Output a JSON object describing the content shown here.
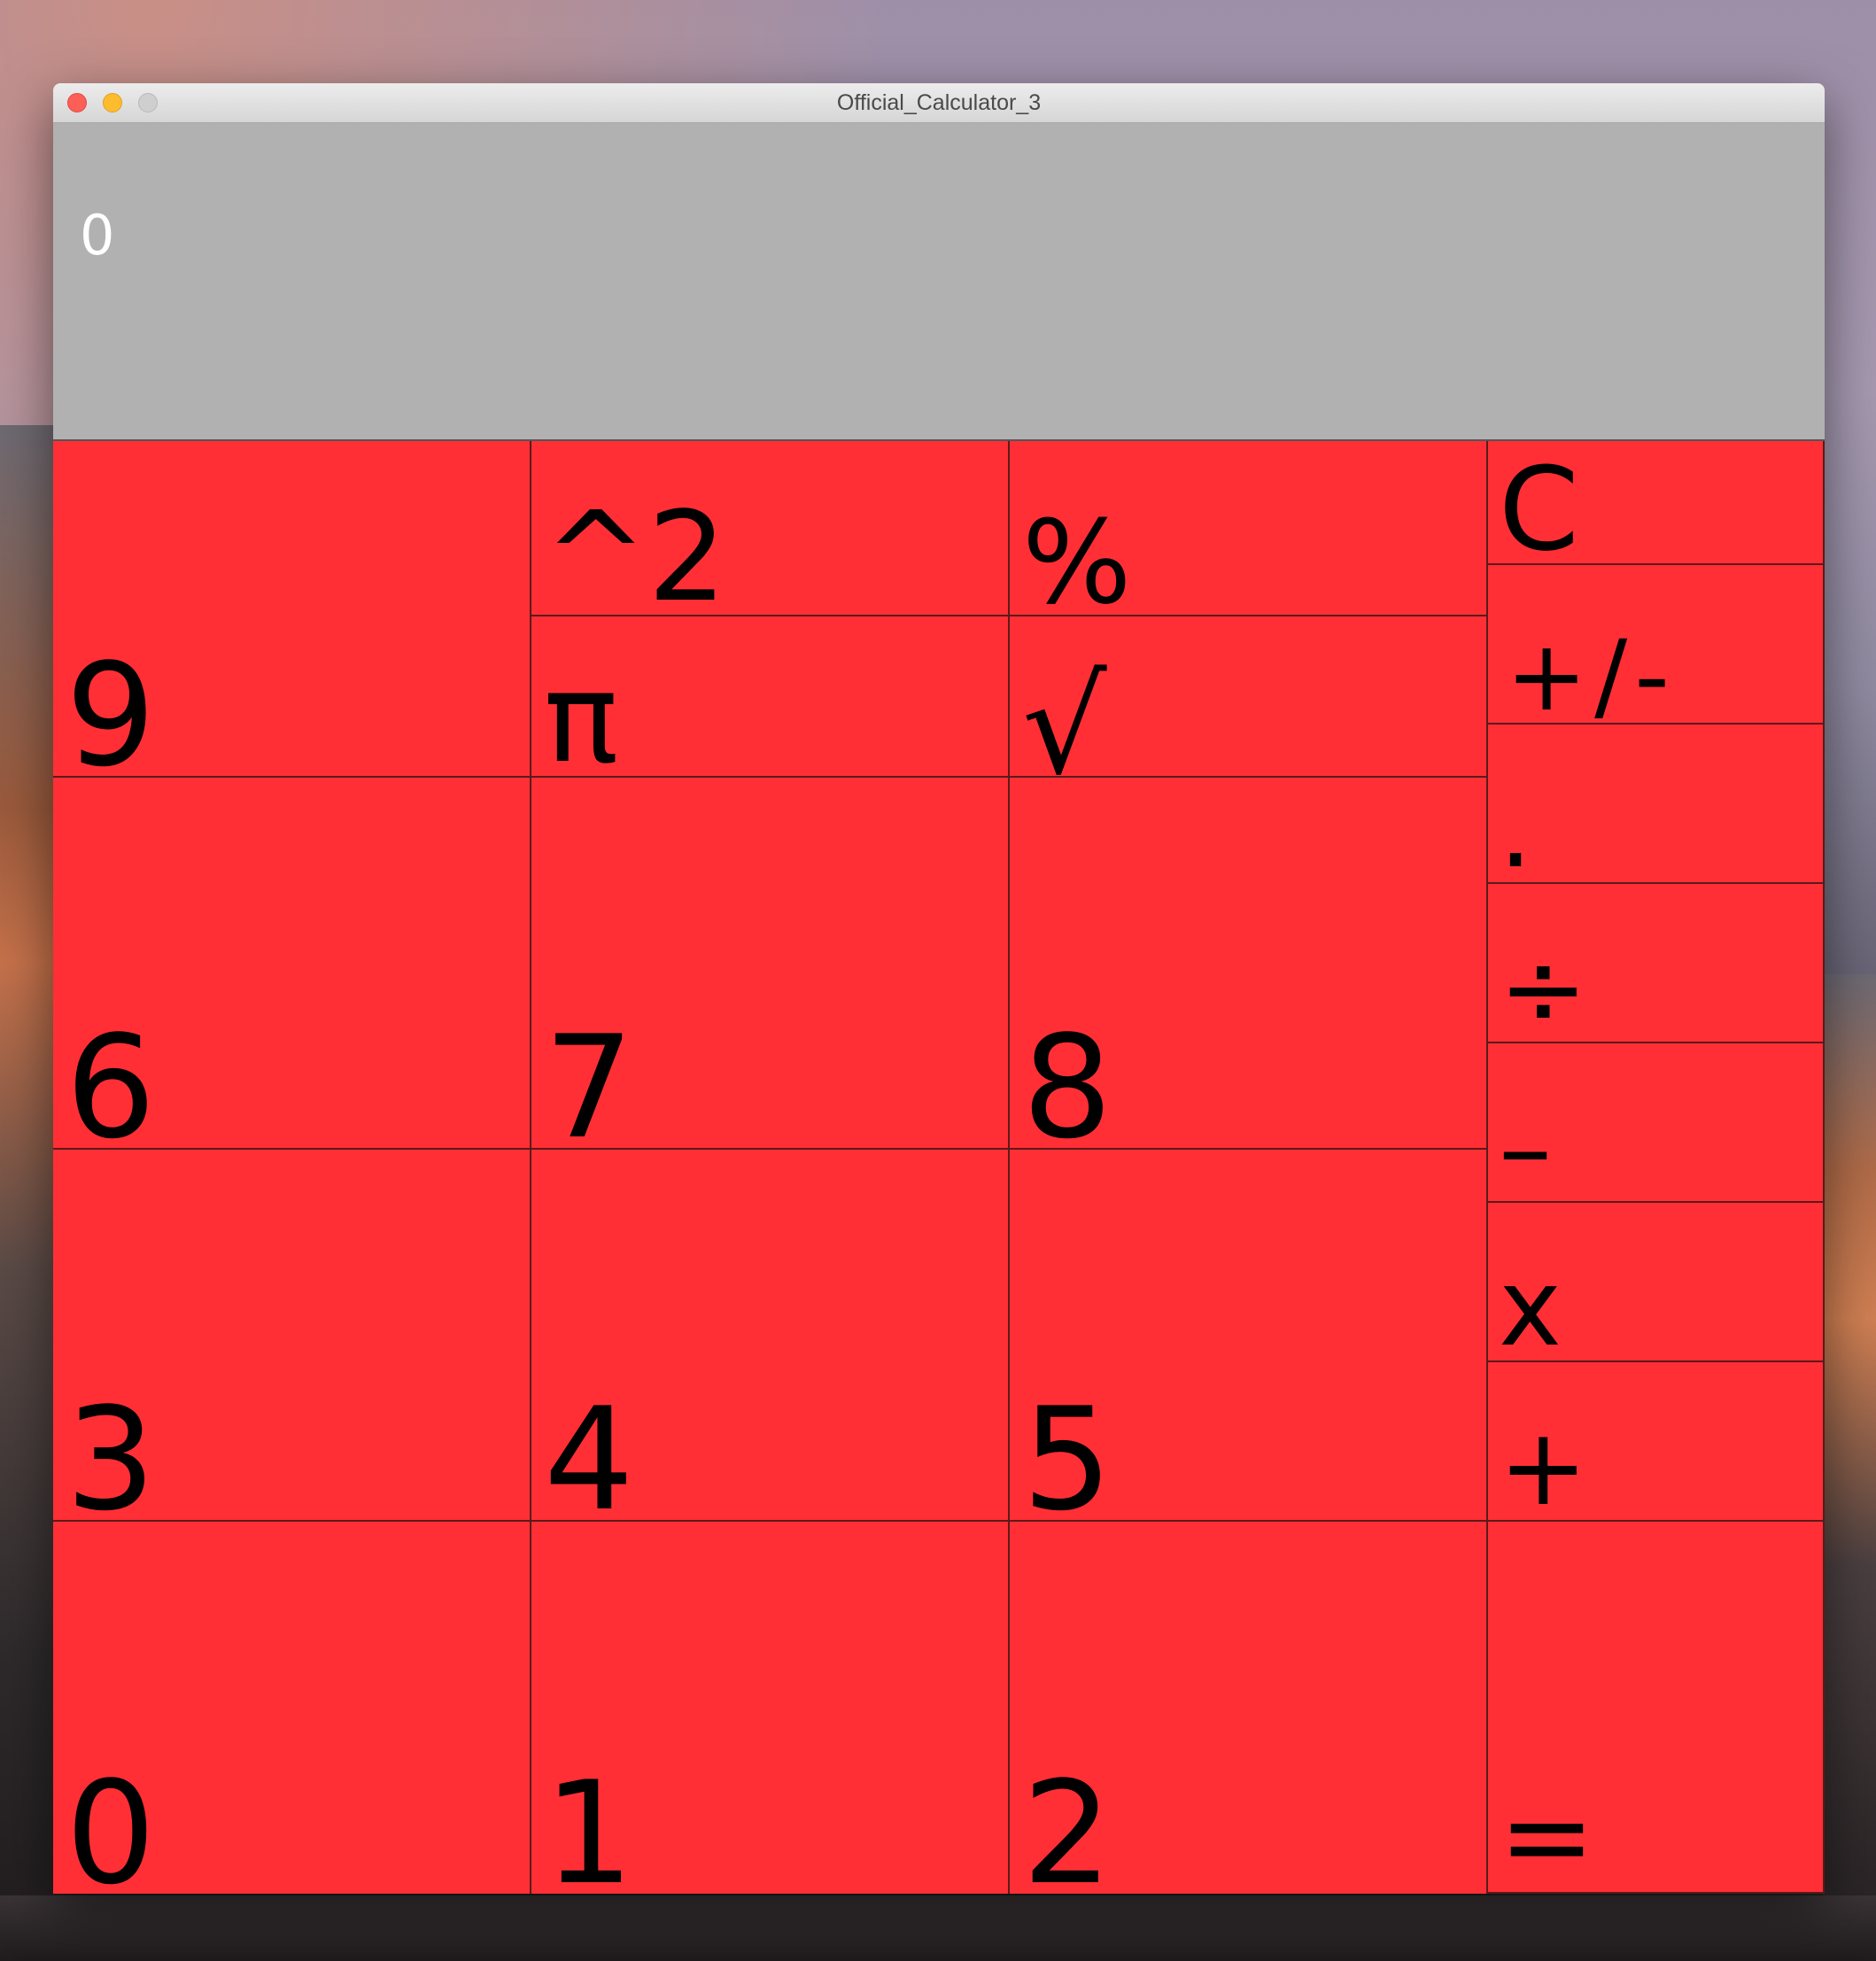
{
  "window": {
    "title": "Official_Calculator_3"
  },
  "display": {
    "value": "0"
  },
  "keys": {
    "k9": "9",
    "square": "^2",
    "percent": "%",
    "pi": "π",
    "sqrt": "√",
    "clear": "C",
    "negate": "+/-",
    "decimal": ".",
    "divide": "÷",
    "subtract": "–",
    "multiply": "x",
    "add": "+",
    "equals": "=",
    "k6": "6",
    "k7": "7",
    "k8": "8",
    "k3": "3",
    "k4": "4",
    "k5": "5",
    "k0": "0",
    "k1": "1",
    "k2": "2"
  },
  "colors": {
    "key_background": "#ff2f35",
    "display_background": "#b1b1b1",
    "display_text": "#ffffff",
    "key_text": "#000000"
  }
}
